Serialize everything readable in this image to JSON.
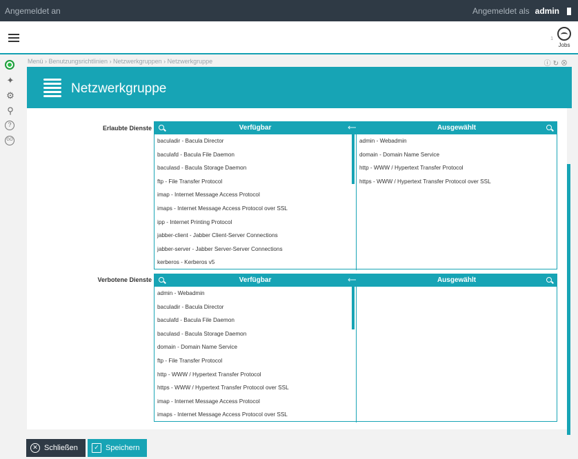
{
  "topbar": {
    "status": "Angemeldet an",
    "logged_in_label": "Angemeldet als",
    "user": "admin"
  },
  "jobs": {
    "label": "Jobs",
    "count": "1"
  },
  "breadcrumb": "Menü › Benutzungsrichtlinien › Netzwerkgruppen › Netzwerkgruppe",
  "page_title": "Netzwerkgruppe",
  "allowed": {
    "label": "Erlaubte Dienste",
    "available_header": "Verfügbar",
    "selected_header": "Ausgewählt",
    "available": [
      "baculadir - Bacula Director",
      "baculafd - Bacula File Daemon",
      "baculasd - Bacula Storage Daemon",
      "ftp - File Transfer Protocol",
      "imap - Internet Message Access Protocol",
      "imaps - Internet Message Access Protocol over SSL",
      "ipp - Internet Printing Protocol",
      "jabber-client - Jabber Client-Server Connections",
      "jabber-server - Jabber Server-Server Connections",
      "kerberos - Kerberos v5"
    ],
    "selected": [
      "admin - Webadmin",
      "domain - Domain Name Service",
      "http - WWW / Hypertext Transfer Protocol",
      "https - WWW / Hypertext Transfer Protocol over SSL"
    ]
  },
  "forbidden": {
    "label": "Verbotene Dienste",
    "available_header": "Verfügbar",
    "selected_header": "Ausgewählt",
    "available": [
      "admin - Webadmin",
      "baculadir - Bacula Director",
      "baculafd - Bacula File Daemon",
      "baculasd - Bacula Storage Daemon",
      "domain - Domain Name Service",
      "ftp - File Transfer Protocol",
      "http - WWW / Hypertext Transfer Protocol",
      "https - WWW / Hypertext Transfer Protocol over SSL",
      "imap - Internet Message Access Protocol",
      "imaps - Internet Message Access Protocol over SSL"
    ],
    "selected": []
  },
  "buttons": {
    "close": "Schließen",
    "save": "Speichern"
  },
  "colors": {
    "accent": "#17a4b5",
    "dark": "#2f3a45"
  }
}
